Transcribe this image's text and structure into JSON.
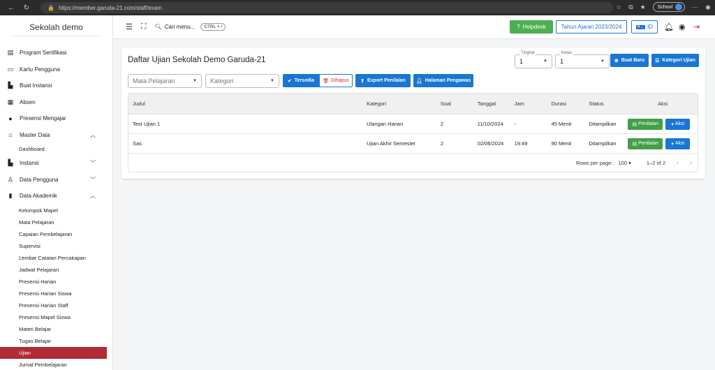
{
  "browser": {
    "url": "https://member.garuda-21.com/staff/exam",
    "profile": "School"
  },
  "sidebar": {
    "title": "Sekolah demo",
    "items": [
      {
        "label": "Program Sertifikasi",
        "icon": "certificate-icon"
      },
      {
        "label": "Kartu Pengguna",
        "icon": "id-card-icon"
      },
      {
        "label": "Buat Instansi",
        "icon": "building-icon"
      },
      {
        "label": "Absen",
        "icon": "calendar-icon"
      },
      {
        "label": "Presensi Mengajar",
        "icon": "check-circle-icon"
      },
      {
        "label": "Master Data",
        "icon": "home-icon"
      }
    ],
    "master_sub": [
      "Dashboard"
    ],
    "items2": [
      {
        "label": "Instansi",
        "icon": "building-icon"
      },
      {
        "label": "Data Pengguna",
        "icon": "user-icon"
      },
      {
        "label": "Data Akademik",
        "icon": "book-icon"
      }
    ],
    "akademik_sub": [
      "Kelompok Mapel",
      "Mata Pelajaran",
      "Capaian Pembelajaran",
      "Supervisi",
      "Lembar Catatan Percakapan",
      "Jadwal Pelajaran",
      "Presensi Harian",
      "Presensi Harian Siswa",
      "Presensi Harian Staff",
      "Presensi Mapel Siswa",
      "Materi Belajar",
      "Tugas Belajar",
      "Ujian",
      "Jurnal Pembelajaran"
    ],
    "active": "Ujian"
  },
  "topbar": {
    "search_label": "Cari menu...",
    "shortcut": "CTRL + /",
    "helpdesk": "Helpdesk",
    "year": "Tahun Ajaran 2023/2024",
    "lang_badge": "A→",
    "lang": "ID"
  },
  "card": {
    "title": "Daftar Ujian Sekolah Demo Garuda-21",
    "tingkat_label": "Tingkat",
    "tingkat_value": "1",
    "kelas_label": "Kelas",
    "kelas_value": "1",
    "buat_baru": "Buat Baru",
    "kategori_ujian": "Kategori Ujian",
    "mapel_placeholder": "Mata Pelajaran",
    "kategori_placeholder": "Kategori",
    "tersedia": "Tersedia",
    "dihapus": "Dihapus",
    "export": "Export Penilaian",
    "pengawas": "Halaman Pengawas"
  },
  "table": {
    "headers": [
      "Judul",
      "Kategori",
      "Soal",
      "Tanggal",
      "Jam",
      "Durasi",
      "Status",
      "Aksi"
    ],
    "rows": [
      [
        "Test Ujian 1",
        "Ulangan Harian",
        "2",
        "11/10/2024",
        "-",
        "45 Menit",
        "Ditampilkan"
      ],
      [
        "Sas",
        "Ujian Akhir Semester",
        "2",
        "02/06/2024",
        "19:49",
        "90 Menit",
        "Ditampilkan"
      ]
    ],
    "btn_penilaian": "Penilaian",
    "btn_aksi": "Aksi",
    "rows_per_page_label": "Rows per page:",
    "rows_per_page": "100",
    "range": "1–2 of 2"
  },
  "colors": {
    "primary": "#1976d2",
    "success": "#43a047",
    "active_menu": "#b22a33",
    "danger": "#d32f2f"
  }
}
